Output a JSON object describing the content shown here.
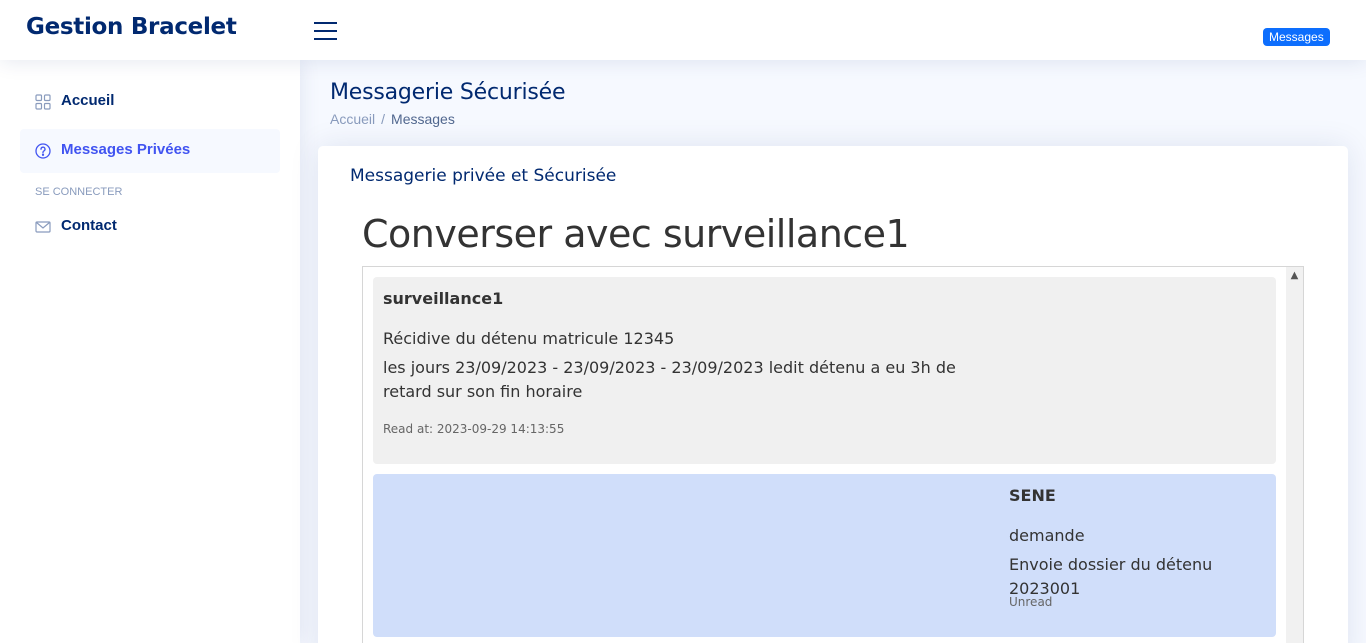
{
  "header": {
    "logo": "Gestion Bracelet",
    "badge": "Messages"
  },
  "sidebar": {
    "items": [
      {
        "label": "Accueil",
        "icon": "grid-icon"
      },
      {
        "label": "Messages Privées",
        "icon": "question-circle-icon",
        "active": true
      }
    ],
    "heading": "SE CONNECTER",
    "items_after": [
      {
        "label": "Contact",
        "icon": "envelope-icon"
      }
    ]
  },
  "page": {
    "title": "Messagerie Sécurisée",
    "breadcrumb": {
      "home": "Accueil",
      "separator": "/",
      "current": "Messages"
    }
  },
  "card": {
    "title": "Messagerie privée et Sécurisée",
    "conversation_title": "Converser avec surveillance1"
  },
  "messages": [
    {
      "author": "surveillance1",
      "subject": "Récidive du détenu matricule 12345",
      "body": "les jours 23/09/2023 - 23/09/2023 - 23/09/2023 ledit détenu a eu 3h de retard sur son fin horaire",
      "status": "Read at: 2023-09-29 14:13:55"
    },
    {
      "author": "SENE",
      "subject": "demande",
      "body": "Envoie dossier du détenu 2023001",
      "status": "Unread"
    }
  ],
  "colors": {
    "brand": "#012970",
    "accent": "#4154f1",
    "badge": "#0d6efd",
    "received_bg": "#f0f0f0",
    "sent_bg": "#d0defa"
  }
}
